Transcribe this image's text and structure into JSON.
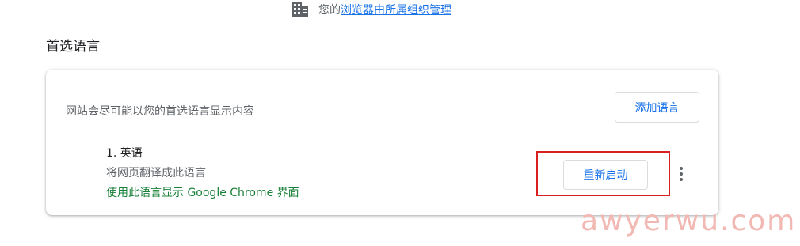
{
  "managed_notice": {
    "prefix": "您的",
    "link": "浏览器由所属组织管理",
    "icon": "building-icon"
  },
  "section": {
    "title": "首选语言"
  },
  "card": {
    "description": "网站会尽可能以您的首选语言显示内容",
    "add_language_label": "添加语言",
    "languages": [
      {
        "name": "1. 英语",
        "translate_text": "将网页翻译成此语言",
        "display_text": "使用此语言显示 Google Chrome 界面",
        "restart_label": "重新启动",
        "menu_icon": "more-vert-icon"
      }
    ]
  },
  "watermark": "awyerwu.com",
  "colors": {
    "accent": "#1a73e8",
    "success": "#188038",
    "highlight_border": "#d9201f",
    "watermark": "#f2b8b3"
  }
}
